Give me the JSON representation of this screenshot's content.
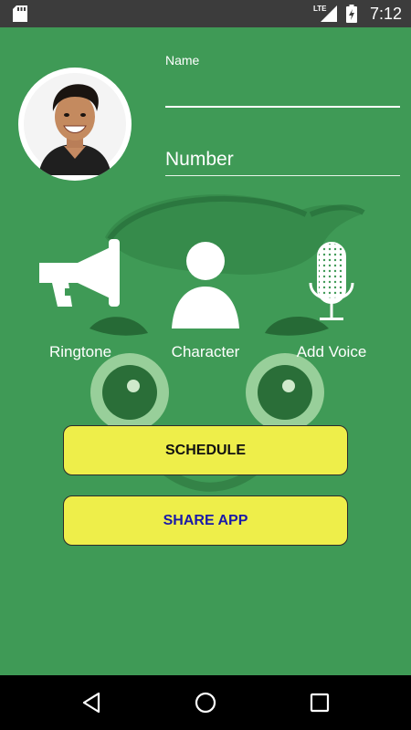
{
  "status_bar": {
    "network_label": "LTE",
    "time": "7:12",
    "icons": [
      "sd-card-icon",
      "lte-signal-icon",
      "battery-charging-icon"
    ]
  },
  "form": {
    "name_label": "Name",
    "name_value": "",
    "number_placeholder": "Number"
  },
  "actions": {
    "ringtone_label": "Ringtone",
    "character_label": "Character",
    "voice_label": "Add Voice"
  },
  "buttons": {
    "schedule_label": "SCHEDULE",
    "share_label": "SHARE APP"
  },
  "colors": {
    "background": "#3f9a56",
    "button_fill": "#eeee4a",
    "share_text": "#1a1aa8"
  },
  "nav": {
    "icons": [
      "back-icon",
      "home-icon",
      "recents-icon"
    ]
  }
}
